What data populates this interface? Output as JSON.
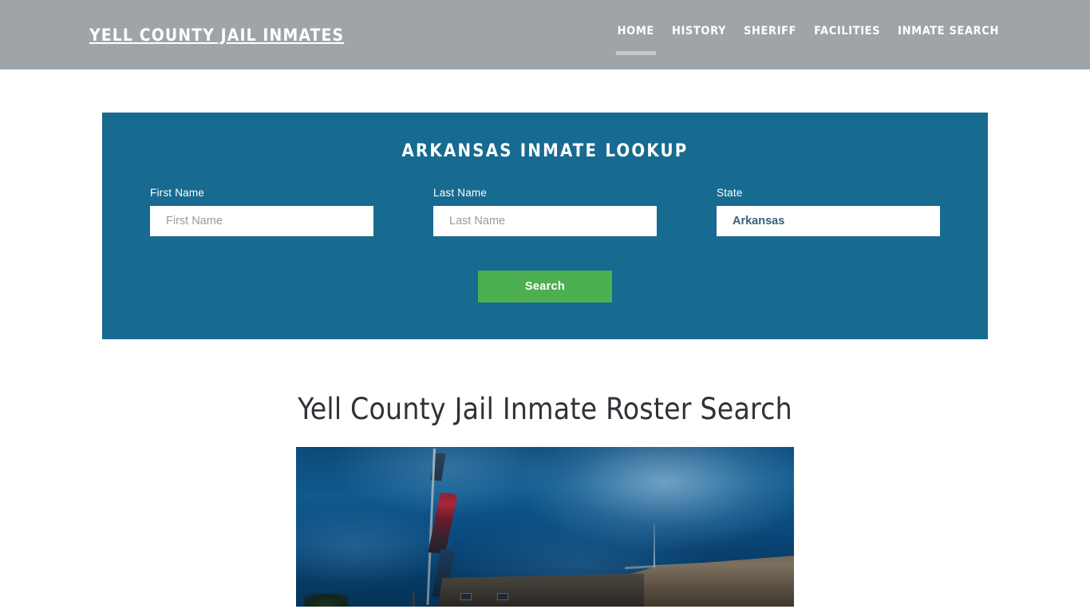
{
  "header": {
    "brand": "YELL COUNTY JAIL INMATES",
    "nav": [
      {
        "label": "HOME",
        "active": true
      },
      {
        "label": "HISTORY",
        "active": false
      },
      {
        "label": "SHERIFF",
        "active": false
      },
      {
        "label": "FACILITIES",
        "active": false
      },
      {
        "label": "INMATE SEARCH",
        "active": false
      }
    ],
    "background_color": "#9ea4a8"
  },
  "lookup": {
    "title": "ARKANSAS INMATE LOOKUP",
    "panel_color": "#176a90",
    "fields": {
      "first_name": {
        "label": "First Name",
        "placeholder": "First Name",
        "value": ""
      },
      "last_name": {
        "label": "Last Name",
        "placeholder": "Last Name",
        "value": ""
      },
      "state": {
        "label": "State",
        "selected": "Arkansas"
      }
    },
    "submit": {
      "label": "Search",
      "color": "#4caf50"
    }
  },
  "main": {
    "page_title": "Yell County Jail Inmate Roster Search",
    "hero_alt": "Yell County Jail building at dusk with flags flying on flagpole"
  }
}
